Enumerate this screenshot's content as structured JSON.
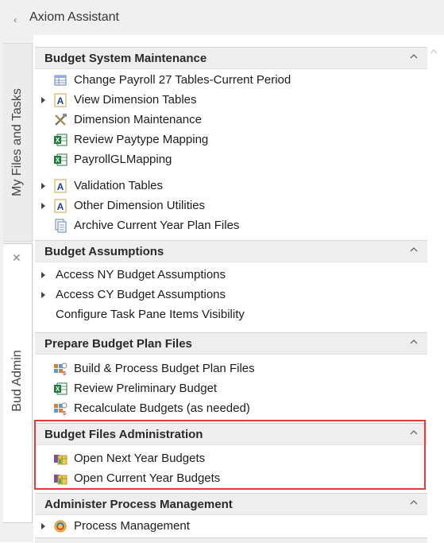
{
  "header": {
    "title": "Axiom Assistant",
    "collapse_icon": "chevron-left-icon"
  },
  "sidebar": {
    "tabs": [
      {
        "label": "My Files and Tasks"
      },
      {
        "label": "Bud Admin"
      }
    ]
  },
  "sections": [
    {
      "title": "Budget System Maintenance",
      "items": [
        {
          "label": "Change Payroll 27 Tables-Current Period",
          "icon": "table-icon",
          "expandable": false
        },
        {
          "label": "View Dimension Tables",
          "icon": "text-a-icon",
          "expandable": true
        },
        {
          "label": "Dimension Maintenance",
          "icon": "tools-icon",
          "expandable": false
        },
        {
          "label": "Review Paytype Mapping",
          "icon": "excel-icon",
          "expandable": false
        },
        {
          "label": "PayrollGLMapping",
          "icon": "excel-icon",
          "expandable": false
        },
        {
          "label": "Validation Tables",
          "icon": "text-a-icon",
          "expandable": true
        },
        {
          "label": "Other Dimension Utilities",
          "icon": "text-a-icon",
          "expandable": true
        },
        {
          "label": "Archive Current Year Plan Files",
          "icon": "document-icon",
          "expandable": false
        }
      ]
    },
    {
      "title": "Budget Assumptions",
      "items": [
        {
          "label": "Access NY Budget Assumptions",
          "expandable": true
        },
        {
          "label": "Access CY Budget Assumptions",
          "expandable": true
        },
        {
          "label": "Configure Task Pane Items Visibility",
          "expandable": false
        }
      ]
    },
    {
      "title": "Prepare Budget Plan Files",
      "items": [
        {
          "label": "Build & Process Budget Plan Files",
          "icon": "process-grid-icon"
        },
        {
          "label": "Review Preliminary Budget",
          "icon": "excel-icon"
        },
        {
          "label": "Recalculate Budgets (as needed)",
          "icon": "process-grid-icon"
        }
      ]
    },
    {
      "title": "Budget Files Administration",
      "items": [
        {
          "label": "Open Next Year Budgets",
          "icon": "open-budget-icon"
        },
        {
          "label": "Open Current Year Budgets",
          "icon": "open-budget-icon"
        }
      ]
    },
    {
      "title": "Administer Process Management",
      "items": [
        {
          "label": "Process Management",
          "icon": "process-management-icon",
          "expandable": true
        }
      ]
    }
  ],
  "colors": {
    "highlight": "#e23b3b",
    "header_bg": "#eeeeee",
    "excel_green": "#1f7a3a",
    "text_a_blue": "#1a3fa6"
  }
}
